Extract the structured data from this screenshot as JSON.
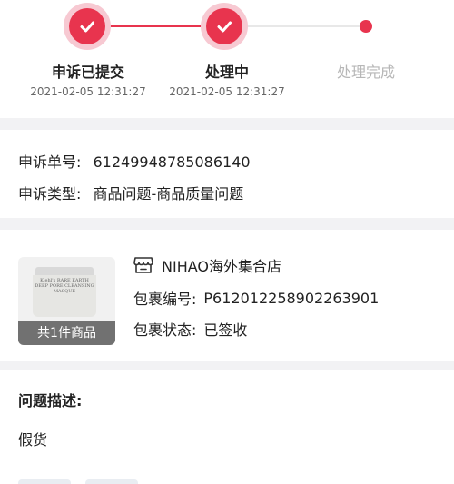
{
  "progress": {
    "steps": [
      {
        "title": "申诉已提交",
        "time": "2021-02-05 12:31:27",
        "state": "done"
      },
      {
        "title": "处理中",
        "time": "2021-02-05 12:31:27",
        "state": "done"
      },
      {
        "title": "处理完成",
        "time": "",
        "state": "pending"
      }
    ],
    "accent_color": "#e8344e"
  },
  "complaint": {
    "number_label": "申诉单号:",
    "number_value": "61249948785086140",
    "type_label": "申诉类型:",
    "type_value": "商品问题-商品质量问题"
  },
  "package": {
    "store_icon": "store-icon",
    "store_name": "NIHAO海外集合店",
    "product_count": "共1件商品",
    "product_image_text": "Kiehl's RARE EARTH DEEP PORE CLEANSING MASQUE",
    "parcel_no_label": "包裹编号:",
    "parcel_no_value": "P612012258902263901",
    "parcel_status_label": "包裹状态:",
    "parcel_status_value": "已签收"
  },
  "description": {
    "label": "问题描述:",
    "text": "假货"
  }
}
